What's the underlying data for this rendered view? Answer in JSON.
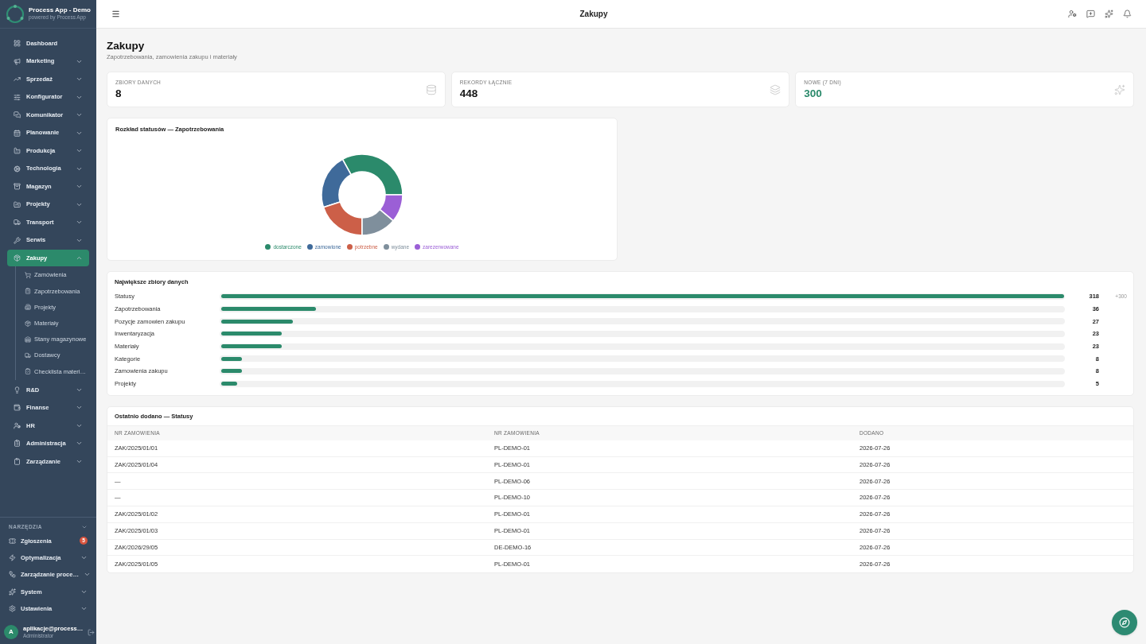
{
  "sidebar": {
    "brand": {
      "title": "Process App - Demo",
      "subtitle": "powered by Process App"
    },
    "nav": [
      {
        "label": "Dashboard",
        "selected": false
      },
      {
        "label": "Marketing",
        "selected": false,
        "expanded": false
      },
      {
        "label": "Sprzedaż",
        "selected": false,
        "expanded": false
      },
      {
        "label": "Konfigurator",
        "selected": false,
        "expanded": false
      },
      {
        "label": "Komunikator",
        "selected": false,
        "expanded": false
      },
      {
        "label": "Planowanie",
        "selected": false,
        "expanded": false
      },
      {
        "label": "Produkcja",
        "selected": false,
        "expanded": false
      },
      {
        "label": "Technologia",
        "selected": false,
        "expanded": false
      },
      {
        "label": "Magazyn",
        "selected": false,
        "expanded": false
      },
      {
        "label": "Projekty",
        "selected": false,
        "expanded": false
      },
      {
        "label": "Transport",
        "selected": false,
        "expanded": false
      },
      {
        "label": "Serwis",
        "selected": false,
        "expanded": false
      },
      {
        "label": "Zakupy",
        "selected": true,
        "expanded": true,
        "children": [
          {
            "label": "Zamówienia",
            "selected": false
          },
          {
            "label": "Zapotrzebowania",
            "selected": false
          },
          {
            "label": "Projekty",
            "selected": false
          },
          {
            "label": "Materiały",
            "selected": false
          },
          {
            "label": "Stany magazynowe",
            "selected": false
          },
          {
            "label": "Dostawcy",
            "selected": false
          },
          {
            "label": "Checklista materi…",
            "selected": false
          }
        ]
      },
      {
        "label": "R&D",
        "selected": false,
        "expanded": false
      },
      {
        "label": "Finanse",
        "selected": false,
        "expanded": false
      },
      {
        "label": "HR",
        "selected": false,
        "expanded": false
      },
      {
        "label": "Administracja",
        "selected": false,
        "expanded": false
      },
      {
        "label": "Zarządzanie",
        "selected": false,
        "expanded": false
      }
    ],
    "tools": {
      "heading": "NARZĘDZIA",
      "items": [
        {
          "label": "Zgłoszenia",
          "selected": false,
          "badge": "5"
        },
        {
          "label": "Optymalizacja",
          "selected": false,
          "expanded": false
        },
        {
          "label": "Zarządzanie proce…",
          "selected": false,
          "expanded": false
        },
        {
          "label": "System",
          "selected": false,
          "expanded": false
        },
        {
          "label": "Ustawienia",
          "selected": false,
          "expanded": false
        }
      ]
    },
    "user": {
      "avatar": "A",
      "email": "aplikacje@process…",
      "role": "Administrator"
    }
  },
  "header": {
    "title": "Zakupy"
  },
  "page": {
    "title": "Zakupy",
    "subtitle": "Zapotrzebowania, zamowienia zakupu i materiały"
  },
  "stats": [
    {
      "label": "ZBIORY DANYCH",
      "value": "8",
      "highlight": false
    },
    {
      "label": "REKORDY ŁĄCZNIE",
      "value": "448",
      "highlight": false
    },
    {
      "label": "NOWE (7 DNI)",
      "value": "300",
      "highlight": true
    }
  ],
  "status_chart": {
    "chart_data": {
      "type": "donut",
      "title": "Rozkład statusów — Zapotrzebowania",
      "categories": [
        "dostarczone",
        "zamowione",
        "potrzebne",
        "wydane",
        "zarezerwowane"
      ],
      "values": [
        33,
        22,
        20,
        14,
        11
      ],
      "colors": [
        "#2b8a6b",
        "#3f6a9a",
        "#cc5f48",
        "#7f8f9c",
        "#9b5fd6"
      ],
      "legend": "bottom"
    }
  },
  "largest_datasets": {
    "title": "Największe zbiory danych",
    "rows": [
      {
        "label": "Statusy",
        "value": "318",
        "level": 1,
        "delta": "+300"
      },
      {
        "label": "Zapotrzebowania",
        "value": "36",
        "level": 0.113
      },
      {
        "label": "Pozycje zamowien zakupu",
        "value": "27",
        "level": 0.085
      },
      {
        "label": "Inwentaryzacja",
        "value": "23",
        "level": 0.072
      },
      {
        "label": "Materiały",
        "value": "23",
        "level": 0.072
      },
      {
        "label": "Kategorie",
        "value": "8",
        "level": 0.025
      },
      {
        "label": "Zamowienia zakupu",
        "value": "8",
        "level": 0.025
      },
      {
        "label": "Projekty",
        "value": "5",
        "level": 0.019
      }
    ]
  },
  "recent": {
    "title": "Ostatnio dodano — Statusy",
    "columns": [
      "NR ZAMOWIENIA",
      "NR ZAMOWIENIA",
      "DODANO"
    ],
    "rows": [
      [
        "ZAK/2025/01/01",
        "PL-DEMO-01",
        "2026-07-26"
      ],
      [
        "ZAK/2025/01/04",
        "PL-DEMO-01",
        "2026-07-26"
      ],
      [
        "—",
        "PL-DEMO-06",
        "2026-07-26"
      ],
      [
        "—",
        "PL-DEMO-10",
        "2026-07-26"
      ],
      [
        "ZAK/2025/01/02",
        "PL-DEMO-01",
        "2026-07-26"
      ],
      [
        "ZAK/2025/01/03",
        "PL-DEMO-01",
        "2026-07-26"
      ],
      [
        "ZAK/2026/29/05",
        "DE-DEMO-16",
        "2026-07-26"
      ],
      [
        "ZAK/2025/01/05",
        "PL-DEMO-01",
        "2026-07-26"
      ]
    ]
  }
}
